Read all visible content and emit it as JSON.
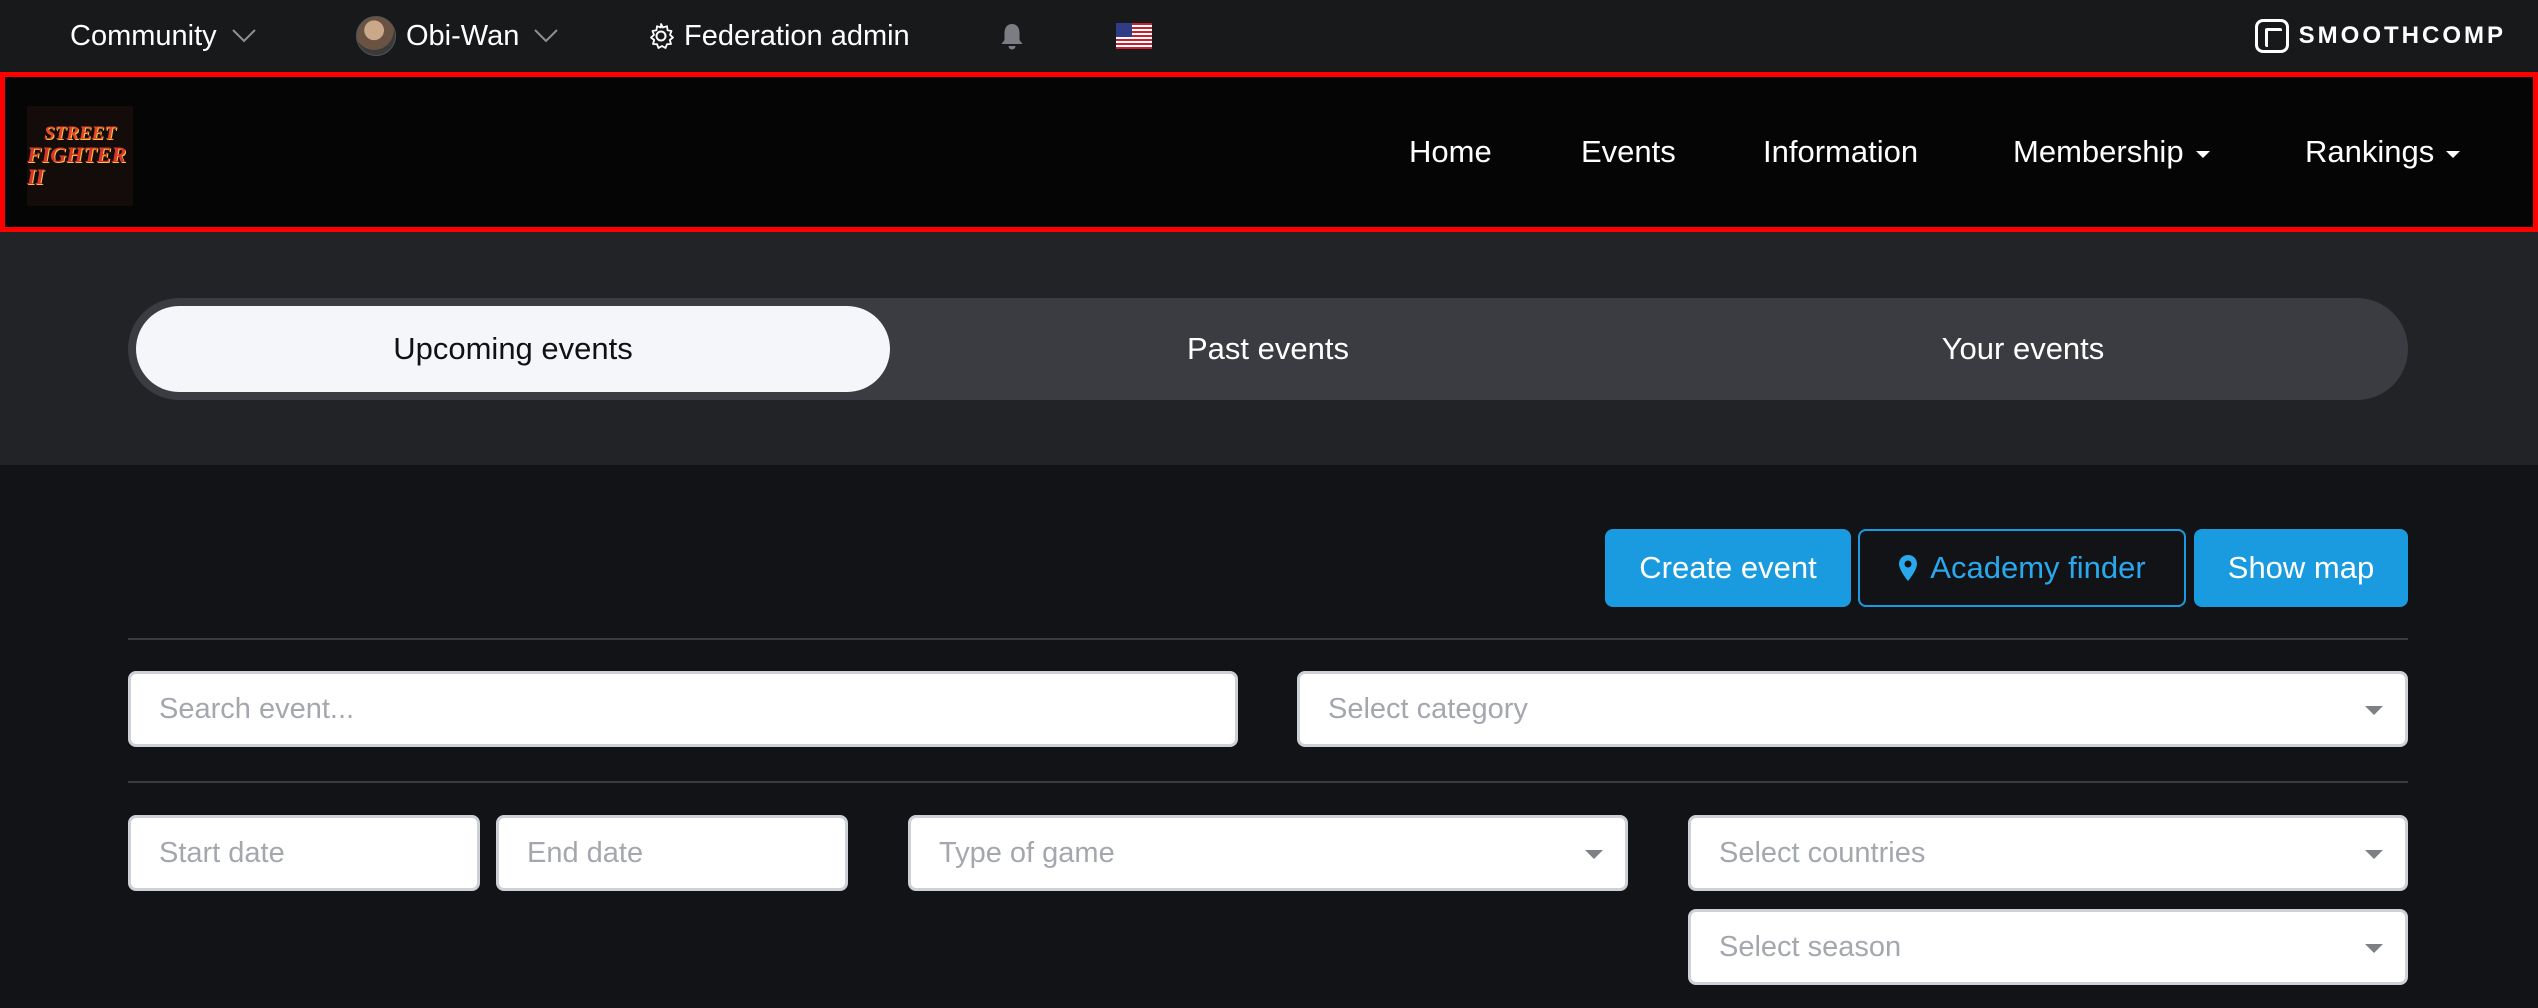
{
  "topbar": {
    "community_label": "Community",
    "user_label": "Obi-Wan",
    "admin_label": "Federation admin",
    "brand": "SMOOTHCOMP"
  },
  "logo": {
    "line1": "STREET",
    "line2": "FIGHTER II"
  },
  "nav": {
    "home": "Home",
    "events": "Events",
    "information": "Information",
    "membership": "Membership",
    "rankings": "Rankings"
  },
  "tabs": {
    "upcoming": "Upcoming events",
    "past": "Past events",
    "yours": "Your events"
  },
  "actions": {
    "create_event": "Create event",
    "academy_finder": "Academy finder",
    "show_map": "Show map"
  },
  "filters": {
    "search_placeholder": "Search event...",
    "category_placeholder": "Select category",
    "start_date_placeholder": "Start date",
    "end_date_placeholder": "End date",
    "game_type_placeholder": "Type of game",
    "countries_placeholder": "Select countries",
    "season_placeholder": "Select season"
  },
  "colors": {
    "accent": "#1a9be0",
    "highlight_border": "#ff0000"
  }
}
